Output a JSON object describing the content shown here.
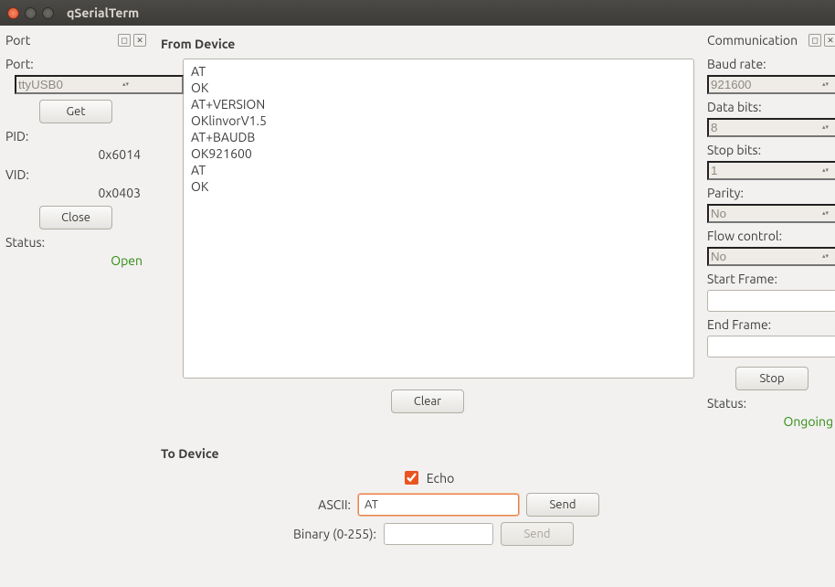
{
  "window": {
    "title": "qSerialTerm"
  },
  "port_panel": {
    "title": "Port",
    "port_label": "Port:",
    "port_value": "ttyUSB0",
    "get_label": "Get",
    "pid_label": "PID:",
    "pid_value": "0x6014",
    "vid_label": "VID:",
    "vid_value": "0x0403",
    "close_label": "Close",
    "status_label": "Status:",
    "status_value": "Open"
  },
  "from_device": {
    "title": "From Device",
    "text": "AT\nOK\nAT+VERSION\nOKlinvorV1.5\nAT+BAUDB\nOK921600\nAT\nOK",
    "clear_label": "Clear"
  },
  "to_device": {
    "title": "To Device",
    "echo_label": "Echo",
    "echo_checked": true,
    "ascii_label": "ASCII:",
    "ascii_value": "AT",
    "binary_label": "Binary (0-255):",
    "binary_value": "",
    "send_label": "Send"
  },
  "comm_panel": {
    "title": "Communication",
    "baud_label": "Baud rate:",
    "baud_value": "921600",
    "data_bits_label": "Data bits:",
    "data_bits_value": "8",
    "stop_bits_label": "Stop bits:",
    "stop_bits_value": "1",
    "parity_label": "Parity:",
    "parity_value": "No",
    "flow_label": "Flow control:",
    "flow_value": "No",
    "start_frame_label": "Start Frame:",
    "start_frame_value": "",
    "end_frame_label": "End Frame:",
    "end_frame_value": "",
    "stop_label": "Stop",
    "status_label": "Status:",
    "status_value": "Ongoing"
  }
}
